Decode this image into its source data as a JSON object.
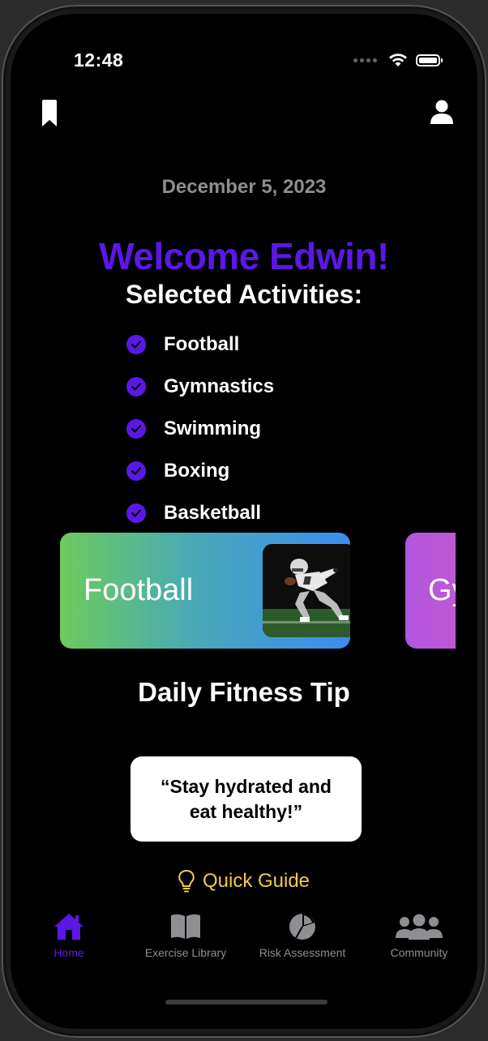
{
  "status_bar": {
    "time": "12:48"
  },
  "date": "December 5, 2023",
  "welcome": "Welcome Edwin!",
  "activities_title": "Selected Activities:",
  "activities": [
    "Football",
    "Gymnastics",
    "Swimming",
    "Boxing",
    "Basketball"
  ],
  "carousel": {
    "cards": [
      {
        "label": "Football",
        "gradient": [
          "#6dcb5c",
          "#3a8df2"
        ]
      },
      {
        "label": "Gymnastics",
        "gradient": [
          "#b355e0",
          "#c85ac9"
        ]
      }
    ]
  },
  "tip": {
    "title": "Daily Fitness Tip",
    "text": "“Stay hydrated and eat healthy!”"
  },
  "guide_label": "Quick Guide",
  "tabs": [
    {
      "label": "Home",
      "icon": "house-icon",
      "active": true
    },
    {
      "label": "Exercise Library",
      "icon": "book-icon",
      "active": false
    },
    {
      "label": "Risk Assessment",
      "icon": "pie-chart-icon",
      "active": false
    },
    {
      "label": "Community",
      "icon": "people-icon",
      "active": false
    }
  ],
  "colors": {
    "accent": "#5b17e6",
    "background": "#000000",
    "muted": "#8e8e93",
    "guide": "#f2c94c"
  }
}
